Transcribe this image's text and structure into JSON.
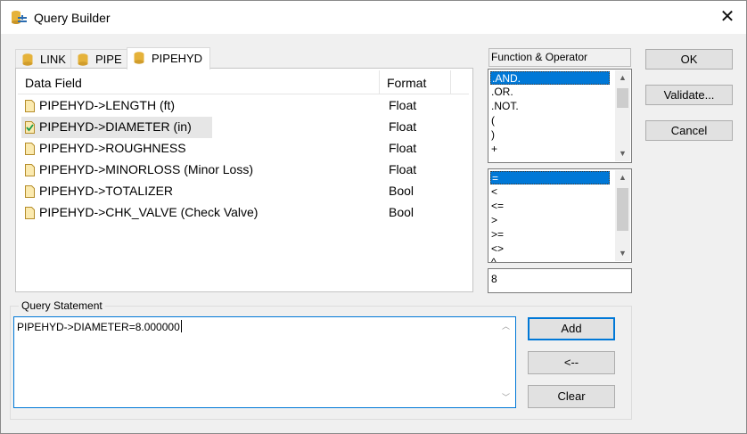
{
  "window": {
    "title": "Query Builder",
    "close_glyph": "✕"
  },
  "tabs": [
    {
      "label": "LINK",
      "active": false
    },
    {
      "label": "PIPE",
      "active": false
    },
    {
      "label": "PIPEHYD",
      "active": true
    }
  ],
  "grid": {
    "columns": [
      "Data Field",
      "Format"
    ],
    "rows": [
      {
        "field": "PIPEHYD->LENGTH (ft)",
        "format": "Float",
        "selected": false
      },
      {
        "field": "PIPEHYD->DIAMETER (in)",
        "format": "Float",
        "selected": true
      },
      {
        "field": "PIPEHYD->ROUGHNESS",
        "format": "Float",
        "selected": false
      },
      {
        "field": "PIPEHYD->MINORLOSS (Minor Loss)",
        "format": "Float",
        "selected": false
      },
      {
        "field": "PIPEHYD->TOTALIZER",
        "format": "Bool",
        "selected": false
      },
      {
        "field": "PIPEHYD->CHK_VALVE (Check Valve)",
        "format": "Bool",
        "selected": false
      }
    ]
  },
  "function_operator": {
    "label": "Function & Operator",
    "functions": [
      ".AND.",
      ".OR.",
      ".NOT.",
      "(",
      ")",
      "+"
    ],
    "functions_selected": ".AND.",
    "comparisons": [
      "=",
      "<",
      "<=",
      ">",
      ">=",
      "<>",
      "^"
    ],
    "comparisons_selected": "=",
    "value": "8"
  },
  "buttons": {
    "ok": "OK",
    "validate": "Validate...",
    "cancel": "Cancel",
    "add": "Add",
    "back": "<--",
    "clear": "Clear"
  },
  "query": {
    "label": "Query Statement",
    "text": "PIPEHYD->DIAMETER=8.000000"
  },
  "colors": {
    "selection": "#0078d7",
    "file_icon": "#e8c872",
    "db_icon": "#e5b23a"
  },
  "icons": {
    "title": "query-builder-icon",
    "tab": "database-icon",
    "row": "file-icon",
    "row_selected": "file-check-icon"
  }
}
